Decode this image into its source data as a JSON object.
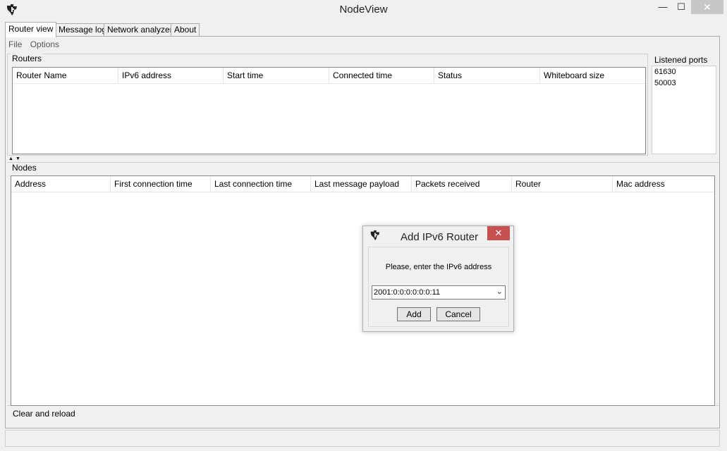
{
  "window": {
    "title": "NodeView",
    "min_glyph": "—",
    "max_glyph": "☐",
    "close_glyph": "✕"
  },
  "tabs": [
    {
      "label": "Router view"
    },
    {
      "label": "Message log"
    },
    {
      "label": "Network analyzer"
    },
    {
      "label": "About"
    }
  ],
  "menu": {
    "file": "File",
    "options": "Options"
  },
  "routers": {
    "title": "Routers",
    "columns": [
      "Router Name",
      "IPv6 address",
      "Start time",
      "Connected time",
      "Status",
      "Whiteboard size"
    ]
  },
  "ports": {
    "title": "Listened ports",
    "items": [
      "61630",
      "50003"
    ]
  },
  "nodes": {
    "title": "Nodes",
    "columns": [
      "Address",
      "First connection time",
      "Last connection time",
      "Last message payload",
      "Packets received",
      "Router",
      "Mac address"
    ]
  },
  "clear_reload": "Clear and reload",
  "dialog": {
    "title": "Add IPv6 Router",
    "close_glyph": "✕",
    "prompt": "Please, enter the IPv6 address",
    "value": "2001:0:0:0:0:0:0:11",
    "caret_glyph": "⌄",
    "add_label": "Add",
    "cancel_label": "Cancel"
  },
  "colors": {
    "dialog_close": "#c75050",
    "background": "#f0f0f0"
  }
}
